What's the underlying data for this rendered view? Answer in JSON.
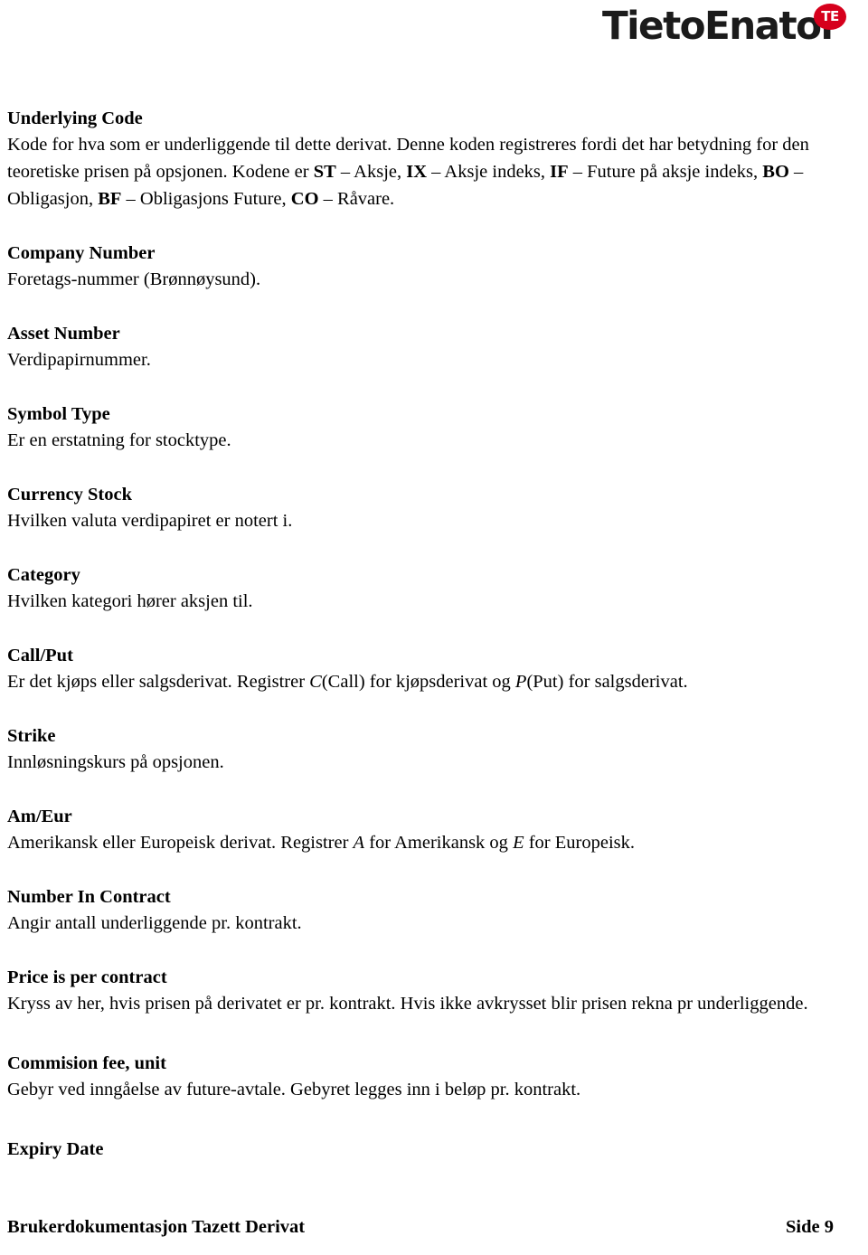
{
  "logo": {
    "wordmark": "TietoEnator",
    "badge_text": "TE",
    "badge_color": "#d6001c",
    "wordmark_color": "#1b1b1b"
  },
  "sections": [
    {
      "heading": "Underlying Code",
      "body_plain": "Kode for hva som er underliggende til dette derivat. Denne koden registreres fordi det har betydning for den teoretiske prisen på opsjonen. Kodene er ST – Aksje, IX – Aksje indeks, IF – Future på aksje indeks, BO – Obligasjon, BF – Obligasjons Future, CO – Råvare.",
      "body_runs": [
        {
          "text": "Kode for hva som er underliggende til dette derivat. Denne koden registreres fordi det har betydning for den teoretiske prisen på opsjonen. Kodene er ",
          "style": "normal"
        },
        {
          "text": "ST",
          "style": "bold"
        },
        {
          "text": " – Aksje, ",
          "style": "normal"
        },
        {
          "text": "IX",
          "style": "bold"
        },
        {
          "text": " – Aksje indeks, ",
          "style": "normal"
        },
        {
          "text": "IF",
          "style": "bold"
        },
        {
          "text": " – Future på aksje indeks, ",
          "style": "normal"
        },
        {
          "text": "BO",
          "style": "bold"
        },
        {
          "text": " – Obligasjon, ",
          "style": "normal"
        },
        {
          "text": "BF",
          "style": "bold"
        },
        {
          "text": " – Obligasjons Future, ",
          "style": "normal"
        },
        {
          "text": "CO",
          "style": "bold"
        },
        {
          "text": " – Råvare.",
          "style": "normal"
        }
      ]
    },
    {
      "heading": "Company Number",
      "body_plain": "Foretags-nummer (Brønnøysund)."
    },
    {
      "heading": "Asset Number",
      "body_plain": "Verdipapirnummer."
    },
    {
      "heading": "Symbol Type",
      "body_plain": "Er en erstatning for stocktype."
    },
    {
      "heading": "Currency Stock",
      "body_plain": "Hvilken valuta verdipapiret er notert i."
    },
    {
      "heading": "Category",
      "body_plain": "Hvilken kategori hører aksjen til."
    },
    {
      "heading": "Call/Put",
      "body_plain": "Er det kjøps eller salgsderivat. Registrer C(Call) for kjøpsderivat og P(Put) for salgsderivat.",
      "body_runs": [
        {
          "text": "Er det kjøps eller salgsderivat. Registrer ",
          "style": "normal"
        },
        {
          "text": "C",
          "style": "italic"
        },
        {
          "text": "(Call) for kjøpsderivat og ",
          "style": "normal"
        },
        {
          "text": "P",
          "style": "italic"
        },
        {
          "text": "(Put) for salgsderivat.",
          "style": "normal"
        }
      ]
    },
    {
      "heading": "Strike",
      "body_plain": "Innløsningskurs på opsjonen."
    },
    {
      "heading": "Am/Eur",
      "body_plain": "Amerikansk eller Europeisk derivat. Registrer A for Amerikansk og E for Europeisk.",
      "body_runs": [
        {
          "text": "Amerikansk eller Europeisk derivat. Registrer ",
          "style": "normal"
        },
        {
          "text": "A",
          "style": "italic"
        },
        {
          "text": " for Amerikansk og ",
          "style": "normal"
        },
        {
          "text": "E",
          "style": "italic"
        },
        {
          "text": " for Europeisk.",
          "style": "normal"
        }
      ]
    },
    {
      "heading": "Number In Contract",
      "body_plain": "Angir antall underliggende pr. kontrakt."
    },
    {
      "heading": "Price is per contract",
      "body_plain": "Kryss av her, hvis prisen på derivatet er pr. kontrakt. Hvis ikke avkrysset blir prisen rekna pr underliggende."
    },
    {
      "heading": "Commision fee, unit",
      "body_plain": "Gebyr ved inngåelse av future-avtale. Gebyret legges inn i beløp pr. kontrakt."
    },
    {
      "heading": "Expiry Date",
      "body_plain": ""
    }
  ],
  "footer": {
    "left": "Brukerdokumentasjon Tazett Derivat",
    "right": "Side 9"
  }
}
